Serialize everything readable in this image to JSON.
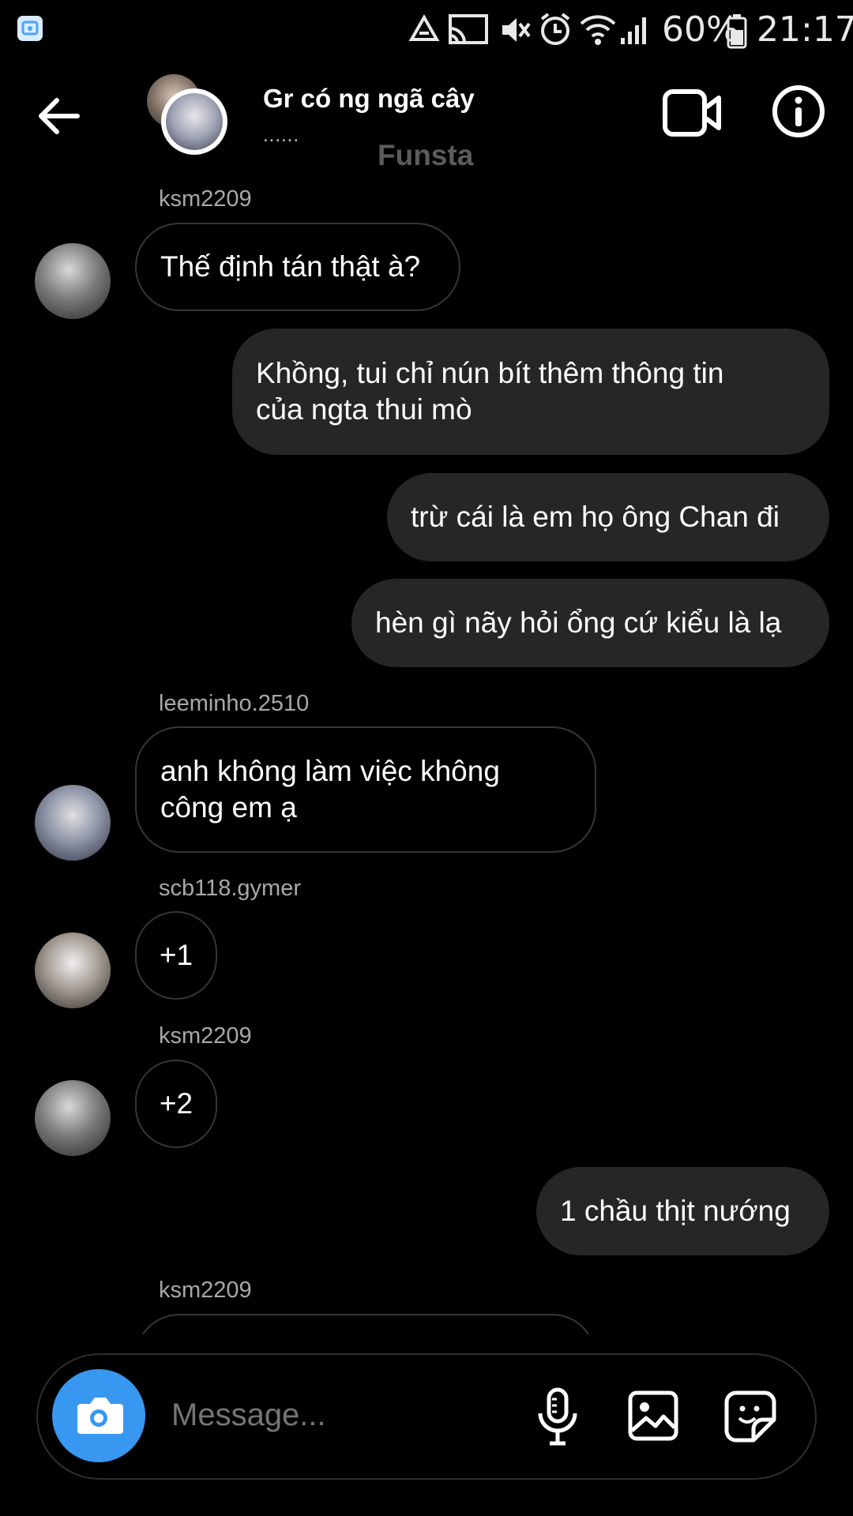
{
  "status_bar": {
    "battery": "60%",
    "time": "21:17",
    "icons": [
      "gallery-notification-icon",
      "recycle-icon",
      "cast-icon",
      "mute-icon",
      "alarm-icon",
      "wifi-icon",
      "signal-icon",
      "battery-icon"
    ]
  },
  "header": {
    "title": "Gr có ng ngã cây",
    "subtitle": "......",
    "label": "Funsta",
    "icons": [
      "back-arrow-icon",
      "video-call-icon",
      "info-icon"
    ]
  },
  "messages": [
    {
      "sender": "ksm2209",
      "text": "Thế định tán thật à?",
      "direction": "in"
    },
    {
      "text_lines": [
        "Khồng, tui chỉ nún bít thêm thông tin",
        "của ngta thui mò"
      ],
      "direction": "out"
    },
    {
      "text": "trừ cái là em họ ông Chan đi",
      "direction": "out"
    },
    {
      "text": "hèn gì nãy hỏi ổng cứ kiểu là lạ",
      "direction": "out"
    },
    {
      "sender": "leeminho.2510",
      "text_lines": [
        "anh không làm việc không",
        "công em ạ"
      ],
      "direction": "in"
    },
    {
      "sender": "scb118.gymer",
      "text": "+1",
      "direction": "in"
    },
    {
      "sender": "ksm2209",
      "text": "+2",
      "direction": "in"
    },
    {
      "text": "1 chầu thịt nướng",
      "direction": "out"
    },
    {
      "sender": "ksm2209",
      "text": "",
      "direction": "in"
    }
  ],
  "composer": {
    "placeholder": "Message...",
    "icons": [
      "camera-icon",
      "microphone-icon",
      "gallery-icon",
      "sticker-icon"
    ],
    "accent_color": "#3897f0"
  }
}
